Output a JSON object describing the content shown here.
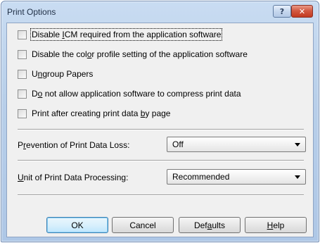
{
  "window": {
    "title": "Print Options",
    "help_glyph": "?",
    "close_glyph": "✕"
  },
  "checkboxes": [
    {
      "pre": "Disable ",
      "acc": "I",
      "post": "CM required from the application software",
      "checked": false
    },
    {
      "pre": "Disable the col",
      "acc": "o",
      "post": "r profile setting of the application software",
      "checked": false
    },
    {
      "pre": "U",
      "acc": "n",
      "post": "group Papers",
      "checked": false
    },
    {
      "pre": "D",
      "acc": "o",
      "post": " not allow application software to compress print data",
      "checked": false
    },
    {
      "pre": "Print after creating print data ",
      "acc": "b",
      "post": "y page",
      "checked": false
    }
  ],
  "prevention": {
    "pre": "P",
    "acc": "r",
    "post": "evention of Print Data Loss:",
    "value": "Off"
  },
  "unit": {
    "pre": "",
    "acc": "U",
    "post": "nit of Print Data Processing:",
    "value": "Recommended"
  },
  "buttons": {
    "ok": "OK",
    "cancel": "Cancel",
    "defaults": {
      "pre": "Def",
      "acc": "a",
      "post": "ults"
    },
    "help": {
      "pre": "",
      "acc": "H",
      "post": "elp"
    }
  }
}
